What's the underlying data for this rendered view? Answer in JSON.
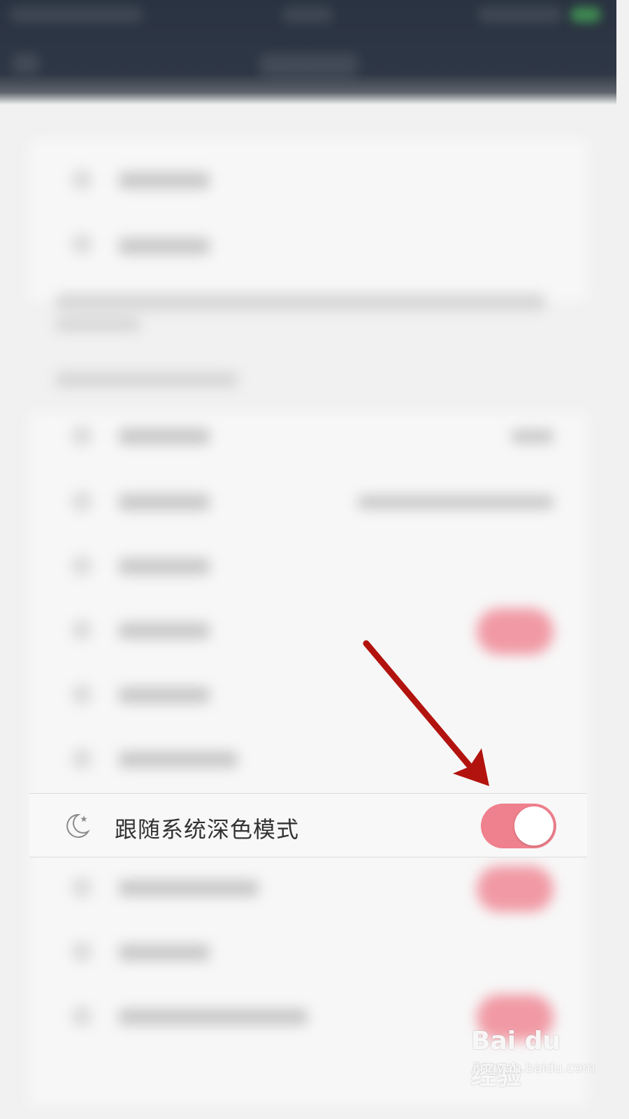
{
  "setting_row": {
    "icon": "moon-icon",
    "label": "跟随系统深色模式",
    "toggle_on": true,
    "toggle_color": "#ef808d"
  },
  "watermark": {
    "logo": "Bai du 经验",
    "url": "jingyan.baidu.com"
  },
  "annotation": {
    "arrow_color": "#b3130e"
  }
}
